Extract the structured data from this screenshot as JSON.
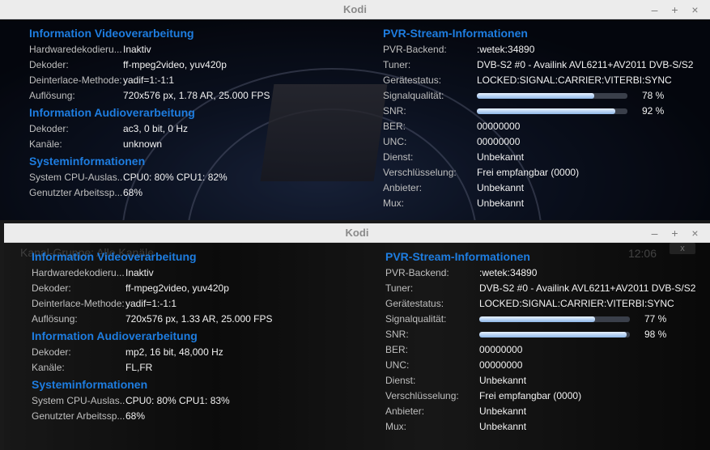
{
  "windows": [
    {
      "title": "Kodi",
      "controls": [
        "–",
        "+",
        "×"
      ],
      "video": {
        "title": "Information Videoverarbeitung",
        "rows": [
          {
            "label": "Hardwaredekodieru...",
            "value": "Inaktiv"
          },
          {
            "label": "Dekoder:",
            "value": "ff-mpeg2video, yuv420p"
          },
          {
            "label": "Deinterlace-Methode:",
            "value": "yadif=1:-1:1"
          },
          {
            "label": "Auflösung:",
            "value": "720x576 px, 1.78 AR, 25.000 FPS"
          }
        ]
      },
      "audio": {
        "title": "Information Audioverarbeitung",
        "rows": [
          {
            "label": "Dekoder:",
            "value": "ac3, 0 bit, 0 Hz"
          },
          {
            "label": "Kanäle:",
            "value": "unknown"
          }
        ]
      },
      "system": {
        "title": "Systeminformationen",
        "rows": [
          {
            "label": "System CPU-Auslas...",
            "value": "CPU0:  80% CPU1:  82%"
          },
          {
            "label": "Genutzter Arbeitssp...",
            "value": "68%"
          }
        ]
      },
      "pvr": {
        "title": "PVR-Stream-Informationen",
        "backend": {
          "label": "PVR-Backend:",
          "value": ":wetek:34890"
        },
        "tuner": {
          "label": "Tuner:",
          "value": "DVB-S2 #0 - Availink AVL6211+AV2011 DVB-S/S2"
        },
        "status": {
          "label": "Gerätestatus:",
          "value": "LOCKED:SIGNAL:CARRIER:VITERBI:SYNC"
        },
        "signal": {
          "label": "Signalqualität:",
          "value": 78,
          "text": "78 %"
        },
        "snr": {
          "label": "SNR:",
          "value": 92,
          "text": "92 %"
        },
        "rows": [
          {
            "label": "BER:",
            "value": "00000000"
          },
          {
            "label": "UNC:",
            "value": "00000000"
          },
          {
            "label": "Dienst:",
            "value": "Unbekannt"
          },
          {
            "label": "Verschlüsselung:",
            "value": "Frei empfangbar (0000)"
          },
          {
            "label": "Anbieter:",
            "value": "Unbekannt"
          },
          {
            "label": "Mux:",
            "value": "Unbekannt"
          }
        ]
      }
    },
    {
      "title": "Kodi",
      "controls": [
        "–",
        "+",
        "×"
      ],
      "overlay": {
        "channel": "Kanal-Gruppe: Alle Kanäle",
        "time": "12:06",
        "close": "x"
      },
      "video": {
        "title": "Information Videoverarbeitung",
        "rows": [
          {
            "label": "Hardwaredekodieru...",
            "value": "Inaktiv"
          },
          {
            "label": "Dekoder:",
            "value": "ff-mpeg2video, yuv420p"
          },
          {
            "label": "Deinterlace-Methode:",
            "value": "yadif=1:-1:1"
          },
          {
            "label": "Auflösung:",
            "value": "720x576 px, 1.33 AR, 25.000 FPS"
          }
        ]
      },
      "audio": {
        "title": "Information Audioverarbeitung",
        "rows": [
          {
            "label": "Dekoder:",
            "value": "mp2, 16 bit, 48,000 Hz"
          },
          {
            "label": "Kanäle:",
            "value": "FL,FR"
          }
        ]
      },
      "system": {
        "title": "Systeminformationen",
        "rows": [
          {
            "label": "System CPU-Auslas...",
            "value": "CPU0:  80% CPU1:  83%"
          },
          {
            "label": "Genutzter Arbeitssp...",
            "value": "68%"
          }
        ]
      },
      "pvr": {
        "title": "PVR-Stream-Informationen",
        "backend": {
          "label": "PVR-Backend:",
          "value": ":wetek:34890"
        },
        "tuner": {
          "label": "Tuner:",
          "value": "DVB-S2 #0 - Availink AVL6211+AV2011 DVB-S/S2"
        },
        "status": {
          "label": "Gerätestatus:",
          "value": "LOCKED:SIGNAL:CARRIER:VITERBI:SYNC"
        },
        "signal": {
          "label": "Signalqualität:",
          "value": 77,
          "text": "77 %"
        },
        "snr": {
          "label": "SNR:",
          "value": 98,
          "text": "98 %"
        },
        "rows": [
          {
            "label": "BER:",
            "value": "00000000"
          },
          {
            "label": "UNC:",
            "value": "00000000"
          },
          {
            "label": "Dienst:",
            "value": "Unbekannt"
          },
          {
            "label": "Verschlüsselung:",
            "value": "Frei empfangbar (0000)"
          },
          {
            "label": "Anbieter:",
            "value": "Unbekannt"
          },
          {
            "label": "Mux:",
            "value": "Unbekannt"
          }
        ]
      }
    }
  ]
}
